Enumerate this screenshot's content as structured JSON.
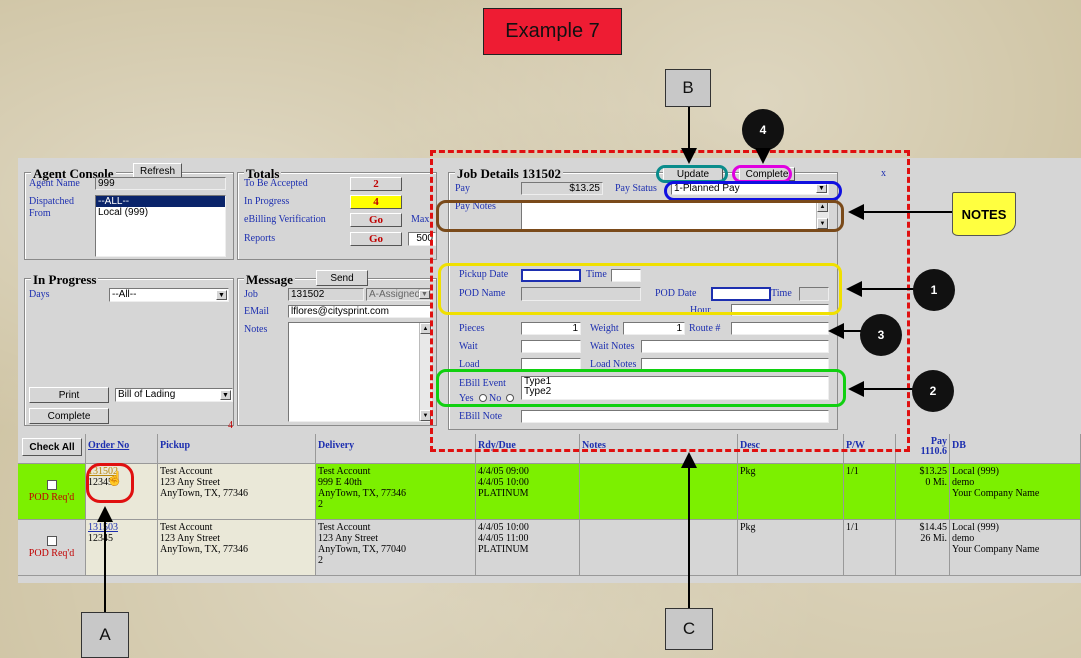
{
  "title": "Example 7",
  "callouts": {
    "b": "B",
    "a": "A",
    "c": "C",
    "notes": "NOTES",
    "n1": "1",
    "n2": "2",
    "n3": "3",
    "n4": "4"
  },
  "agent": {
    "title": "Agent Console",
    "refresh": "Refresh",
    "name_label": "Agent Name",
    "name_value": "999",
    "dispatched_label": "Dispatched",
    "from_label": "From",
    "list": [
      "--ALL--",
      "Local (999)"
    ]
  },
  "totals": {
    "title": "Totals",
    "rows": [
      {
        "label": "To Be Accepted",
        "value": "2"
      },
      {
        "label": "In Progress",
        "value": "4"
      },
      {
        "label": "eBilling Verification",
        "value": "Go"
      },
      {
        "label": "Reports",
        "value": "Go"
      }
    ],
    "max_label": "Max",
    "max_value": "500"
  },
  "job": {
    "title": "Job Details 131502",
    "update": "Update",
    "complete": "Complete",
    "x": "x",
    "pay_label": "Pay",
    "pay_value": "$13.25",
    "pay_status_label": "Pay Status",
    "pay_status_value": "1-Planned Pay",
    "pay_notes_label": "Pay Notes",
    "pickup_date_label": "Pickup Date",
    "time_label": "Time",
    "pod_name_label": "POD Name",
    "pod_date_label": "POD Date",
    "time2_label": "Time",
    "hour_label": "Hour",
    "pieces_label": "Pieces",
    "pieces_value": "1",
    "weight_label": "Weight",
    "weight_value": "1",
    "route_label": "Route #",
    "wait_label": "Wait",
    "wait_notes_label": "Wait Notes",
    "load_label": "Load",
    "load_notes_label": "Load Notes",
    "ebill_event_label": "EBill Event",
    "ebill_types": [
      "Type1",
      "Type2"
    ],
    "yes_label": "Yes",
    "no_label": "No",
    "ebill_note_label": "EBill Note"
  },
  "inprogress": {
    "title": "In Progress",
    "days_label": "Days",
    "days_value": "--All--",
    "print": "Print",
    "print_option": "Bill of Lading",
    "complete": "Complete",
    "count": "4"
  },
  "message": {
    "title": "Message",
    "send": "Send",
    "job_label": "Job",
    "job_value": "131502",
    "job_status": "A-Assigned",
    "email_label": "EMail",
    "email_value": "lflores@citysprint.com",
    "notes_label": "Notes"
  },
  "table": {
    "check_all": "Check All",
    "headers": [
      "Order No",
      "Pickup",
      "Delivery",
      "Rdy/Due",
      "Notes",
      "Desc",
      "P/W",
      "DB"
    ],
    "pay_header": "Pay",
    "pay_total": "1110.6",
    "rows": [
      {
        "order": "131502",
        "ref": "12345",
        "pod": "POD Req'd",
        "pickup": [
          "Test Account",
          "123 Any Street",
          "AnyTown, TX, 77346"
        ],
        "delivery": [
          "Test Account",
          "999 E 40th",
          "AnyTown, TX, 77346",
          "2"
        ],
        "rdy": [
          "4/4/05 09:00",
          "4/4/05 10:00",
          "PLATINUM"
        ],
        "desc": "Pkg",
        "pw": "1/1",
        "pay": "$13.25",
        "mi": "0 Mi.",
        "db": [
          "Local (999)",
          "demo",
          "Your Company Name"
        ]
      },
      {
        "order": "131503",
        "ref": "12345",
        "pod": "POD Req'd",
        "pickup": [
          "Test Account",
          "123 Any Street",
          "AnyTown, TX, 77346"
        ],
        "delivery": [
          "Test Account",
          "123 Any Street",
          "AnyTown, TX, 77040",
          "2"
        ],
        "rdy": [
          "4/4/05 10:00",
          "4/4/05 11:00",
          "PLATINUM"
        ],
        "desc": "Pkg",
        "pw": "1/1",
        "pay": "$14.45",
        "mi": "26 Mi.",
        "db": [
          "Local (999)",
          "demo",
          "Your Company Name"
        ]
      }
    ]
  }
}
